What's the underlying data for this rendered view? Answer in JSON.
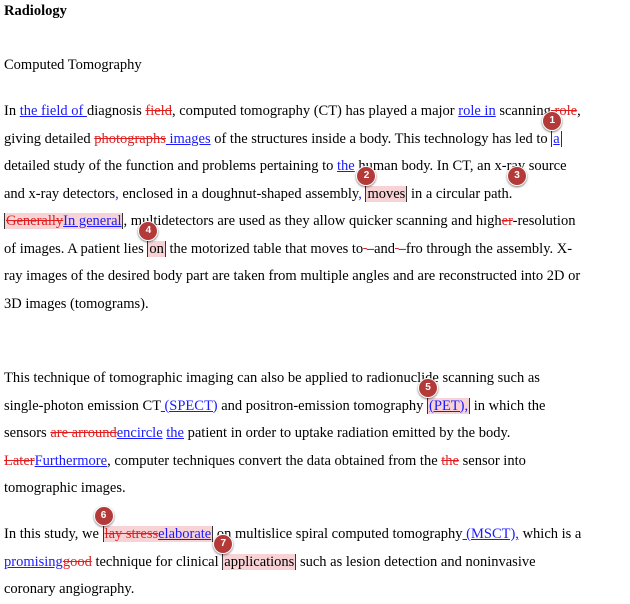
{
  "document": {
    "title": "Radiology",
    "subtitle": "Computed Tomography"
  },
  "para1": {
    "s1": "In ",
    "i1": "the field of ",
    "s2": "diagnosis ",
    "d1": "field",
    "s3": ", computed tomography (CT) has played a major ",
    "i2": "role in",
    "s4": " scanning",
    "d2": " role",
    "s5": ", giving detailed ",
    "d3": "photographs",
    "i3": " images",
    "s6": " of the structures inside a body. This technology has led to ",
    "i4": "a",
    "s7": " detailed study of the function and problems pertaining to ",
    "i5": "the",
    "s8": " human body. In CT, an x-ray source and x-ray detectors",
    "i6": ",",
    "s9": " enclosed in a doughnut-shaped assembly",
    "i7": ",",
    "s10": " ",
    "h1": "moves",
    "s11": " in a circular path. ",
    "d4": "Generally",
    "i8": "In general",
    "s12": ", multidetectors are used as they allow quicker scanning and high",
    "d5": "er",
    "s13": "-resolution of images. A patient lies ",
    "h2": "on",
    "s14": " the motorized table that moves to",
    "d6": " ",
    "s15": "–and",
    "d7": " ",
    "s16": "–fro through the assembly. X-ray images of the desired body part are taken from multiple angles and are reconstructed into 2D or 3D images (tomograms)."
  },
  "para2": {
    "s1": "This technique of tomographic imaging can also be applied to radionuclide scanning such as single-photon emission CT",
    "i1": " (SPECT)",
    "s2": " and positron-emission tomography ",
    "i2": "(PET),",
    "s3": " in which the sensors ",
    "d1": "are arround",
    "i3": "encircle",
    "s4": " ",
    "i4": "the",
    "s5": " patient in order to uptake radiation emitted by the body. ",
    "d2": "Later",
    "i5": "Furthermore",
    "s6": ", computer techniques convert the data obtained from the ",
    "d3": "the",
    "s7": " sensor into tomographic images."
  },
  "para3": {
    "s1": "In this study, we ",
    "d1": "lay stress",
    "i1": "elaborate",
    "s2": " on multislice spiral computed tomography",
    "i2": " (MSCT),",
    "s3": " which is a ",
    "i3": "promising",
    "d2": "good",
    "s4": " technique for clinical ",
    "h1": "applications",
    "s5": " such as lesion detection and noninvasive coronary angiography."
  },
  "comments": [
    "1",
    "2",
    "3",
    "4",
    "5",
    "6",
    "7"
  ],
  "colors": {
    "insertion": "#1a1aff",
    "deletion": "#e02020",
    "highlight": "#f7d3d6",
    "comment_badge": "#b43a3a"
  }
}
